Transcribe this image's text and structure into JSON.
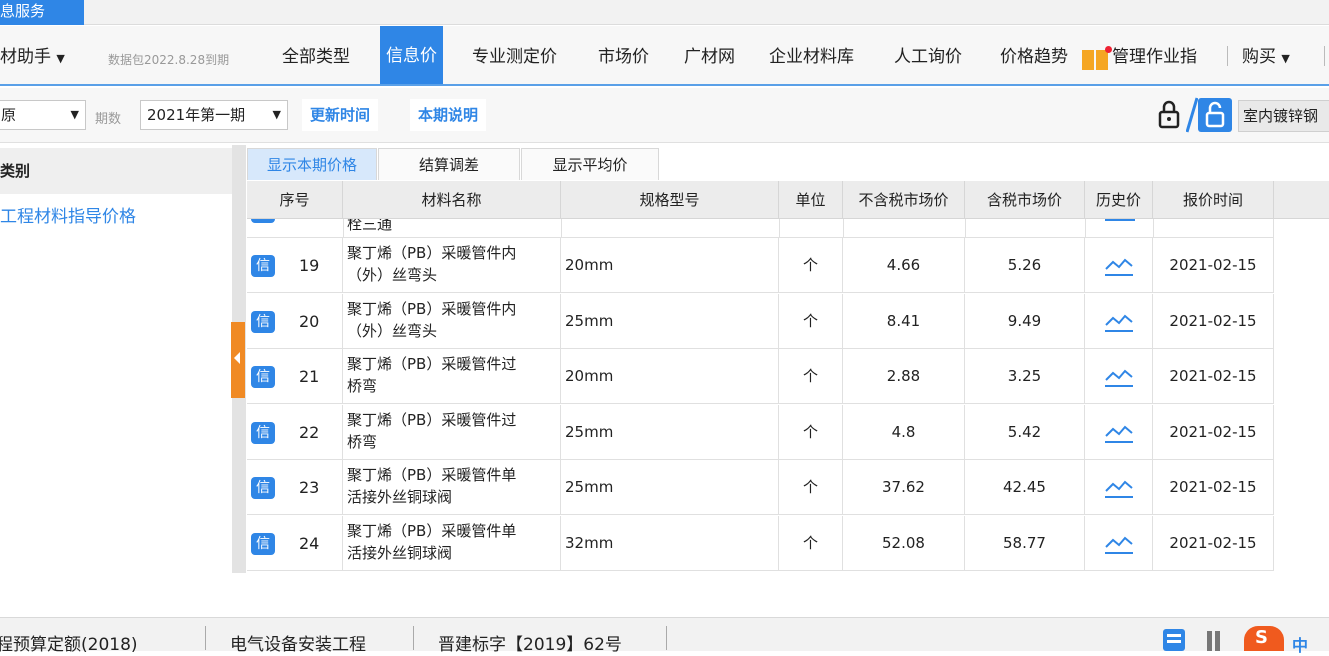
{
  "window": {
    "service_tab": "息服务"
  },
  "menu": {
    "assistant_label": "材助手",
    "data_pack": "数据包2022.8.28到期",
    "items": [
      "全部类型",
      "信息价",
      "专业测定价",
      "市场价",
      "广材网",
      "企业材料库",
      "人工询价",
      "价格趋势",
      "管理作业指"
    ],
    "buy_label": "购买"
  },
  "toolbar": {
    "region_value": "原",
    "period_label": "期数",
    "period_value": "2021年第一期",
    "update_time_label": "更新时间",
    "period_desc_label": "本期说明",
    "material_tag": "室内镀锌钢"
  },
  "left_panel": {
    "header": "类别",
    "item": "工程材料指导价格"
  },
  "subtabs": [
    "显示本期价格",
    "结算调差",
    "显示平均价"
  ],
  "table": {
    "columns": [
      "序号",
      "材料名称",
      "规格型号",
      "单位",
      "不含税市场价",
      "含税市场价",
      "历史价",
      "报价时间"
    ],
    "partial_row_name": "栓三通",
    "badge": "信",
    "rows": [
      {
        "seq": "19",
        "name_line1": "聚丁烯（PB）采暖管件内",
        "name_line2": "（外）丝弯头",
        "spec": "20mm",
        "unit": "个",
        "price_ex_tax": "4.66",
        "price_tax": "5.26",
        "date": "2021-02-15"
      },
      {
        "seq": "20",
        "name_line1": "聚丁烯（PB）采暖管件内",
        "name_line2": "（外）丝弯头",
        "spec": "25mm",
        "unit": "个",
        "price_ex_tax": "8.41",
        "price_tax": "9.49",
        "date": "2021-02-15"
      },
      {
        "seq": "21",
        "name_line1": "聚丁烯（PB）采暖管件过",
        "name_line2": "桥弯",
        "spec": "20mm",
        "unit": "个",
        "price_ex_tax": "2.88",
        "price_tax": "3.25",
        "date": "2021-02-15"
      },
      {
        "seq": "22",
        "name_line1": "聚丁烯（PB）采暖管件过",
        "name_line2": "桥弯",
        "spec": "25mm",
        "unit": "个",
        "price_ex_tax": "4.8",
        "price_tax": "5.42",
        "date": "2021-02-15"
      },
      {
        "seq": "23",
        "name_line1": "聚丁烯（PB）采暖管件单",
        "name_line2": "活接外丝铜球阀",
        "spec": "25mm",
        "unit": "个",
        "price_ex_tax": "37.62",
        "price_tax": "42.45",
        "date": "2021-02-15"
      },
      {
        "seq": "24",
        "name_line1": "聚丁烯（PB）采暖管件单",
        "name_line2": "活接外丝铜球阀",
        "spec": "32mm",
        "unit": "个",
        "price_ex_tax": "52.08",
        "price_tax": "58.77",
        "date": "2021-02-15"
      }
    ]
  },
  "statusbar": {
    "quota": "程预算定额(2018)",
    "discipline": "电气设备安装工程",
    "doc": "晋建标字【2019】62号",
    "ime": "中"
  },
  "colors": {
    "accent": "#2f86e6",
    "orange": "#f08a24"
  }
}
